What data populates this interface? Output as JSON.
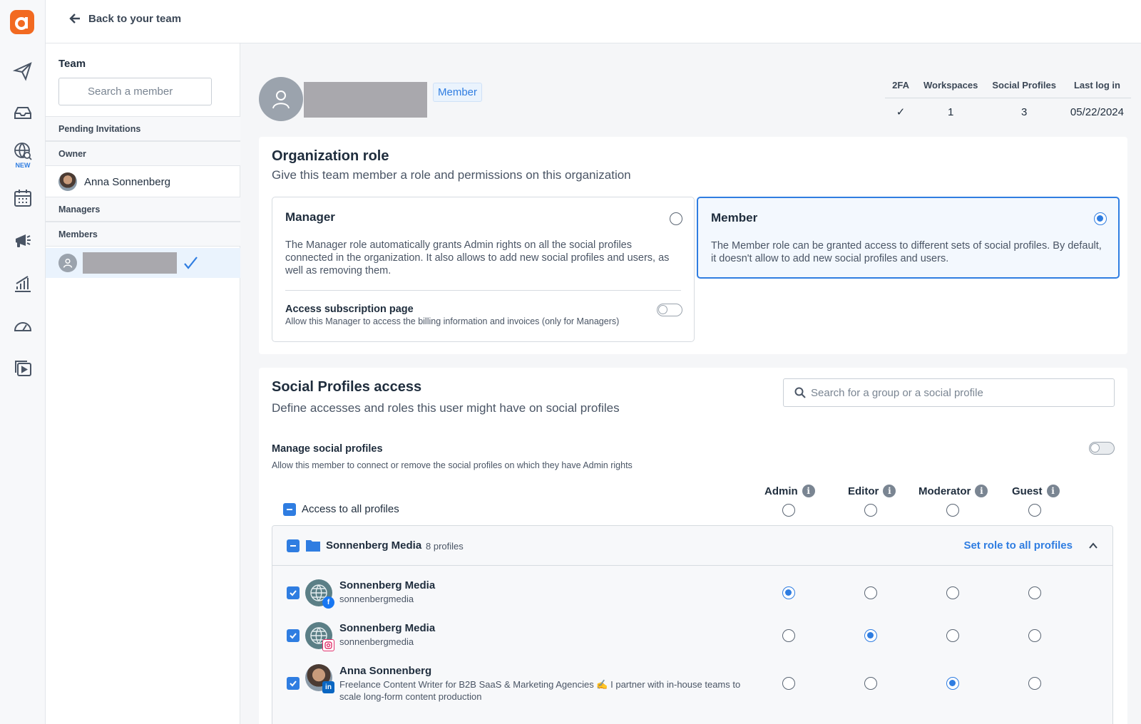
{
  "topbar": {
    "back_label": "Back to your team"
  },
  "rail": {
    "new_badge": "NEW"
  },
  "team": {
    "title": "Team",
    "search_placeholder": "Search a member",
    "sections": {
      "pending": "Pending Invitations",
      "owner": "Owner",
      "managers": "Managers",
      "members": "Members"
    },
    "owner_name": "Anna Sonnenberg"
  },
  "profile": {
    "role_badge": "Member",
    "stats": {
      "headers": [
        "2FA",
        "Workspaces",
        "Social Profiles",
        "Last log in"
      ],
      "values": [
        "✓",
        "1",
        "3",
        "05/22/2024"
      ]
    }
  },
  "org_role": {
    "title": "Organization role",
    "subtitle": "Give this team member a role and permissions on this organization",
    "manager": {
      "title": "Manager",
      "description": "The Manager role automatically grants Admin rights on all the social profiles connected in the organization. It also allows to add new social profiles and users, as well as removing them.",
      "option_title": "Access subscription page",
      "option_desc": "Allow this Manager to access the billing information and invoices (only for Managers)"
    },
    "member": {
      "title": "Member",
      "description": "The Member role can be granted access to different sets of social profiles. By default, it doesn't allow to add new social profiles and users."
    },
    "selected": "member"
  },
  "social": {
    "title": "Social Profiles access",
    "subtitle": "Define accesses and roles this user might have on social profiles",
    "search_placeholder": "Search for a group or a social profile",
    "manage_title": "Manage social profiles",
    "manage_desc": "Allow this member to connect or remove the social profiles on which they have Admin rights",
    "roles": [
      "Admin",
      "Editor",
      "Moderator",
      "Guest"
    ],
    "access_all_label": "Access to all profiles",
    "group": {
      "name": "Sonnenberg Media",
      "count": "8 profiles",
      "set_role_label": "Set role to all profiles"
    },
    "profiles": [
      {
        "name": "Sonnenberg Media",
        "handle": "sonnenbergmedia",
        "network": "facebook",
        "role": "Admin"
      },
      {
        "name": "Sonnenberg Media",
        "handle": "sonnenbergmedia",
        "network": "instagram",
        "role": "Editor"
      },
      {
        "name": "Anna Sonnenberg",
        "handle": "Freelance Content Writer for B2B SaaS & Marketing Agencies ✍️ I partner with in-house teams to scale long-form content production",
        "network": "linkedin",
        "role": "Moderator"
      }
    ]
  },
  "colors": {
    "accent": "#2f7de1",
    "brand": "#f26a21"
  }
}
